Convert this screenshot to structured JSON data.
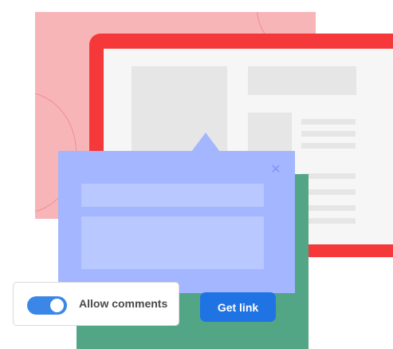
{
  "toggle": {
    "label": "Allow comments",
    "state": "on",
    "color": "#3b87e8"
  },
  "get_link_button": {
    "label": "Get link",
    "color": "#1f73e3"
  },
  "popover": {
    "color": "#a3b6ff",
    "close_icon": "close-icon",
    "close_glyph": "✕"
  },
  "colors": {
    "pink_card": "#f7b5b8",
    "browser_frame": "#f5393a",
    "green_card": "#53a685"
  }
}
